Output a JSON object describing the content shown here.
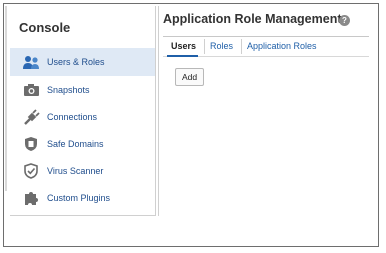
{
  "sidebar": {
    "title": "Console",
    "items": [
      {
        "label": "Users & Roles",
        "icon": "users-icon",
        "selected": true
      },
      {
        "label": "Snapshots",
        "icon": "camera-icon",
        "selected": false
      },
      {
        "label": "Connections",
        "icon": "plug-icon",
        "selected": false
      },
      {
        "label": "Safe Domains",
        "icon": "shield-icon",
        "selected": false
      },
      {
        "label": "Virus Scanner",
        "icon": "shield-check-icon",
        "selected": false
      },
      {
        "label": "Custom Plugins",
        "icon": "puzzle-icon",
        "selected": false
      }
    ]
  },
  "main": {
    "title": "Application Role Management",
    "help_icon": "?",
    "tabs": [
      {
        "label": "Users",
        "active": true
      },
      {
        "label": "Roles",
        "active": false
      },
      {
        "label": "Application Roles",
        "active": false
      }
    ],
    "add_label": "Add"
  },
  "colors": {
    "accent": "#1f5fa8",
    "nav_text": "#1f4d8c",
    "selected_bg": "#dfe9f5"
  }
}
